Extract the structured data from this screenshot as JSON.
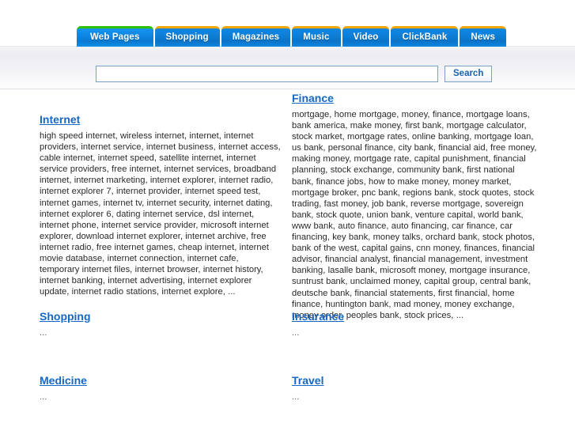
{
  "header": {
    "tabs": [
      {
        "label": "Web Pages",
        "active": true,
        "accent": "#2fc000"
      },
      {
        "label": "Shopping",
        "active": false,
        "accent": "#f0a500"
      },
      {
        "label": "Magazines",
        "active": false,
        "accent": "#f0a500"
      },
      {
        "label": "Music",
        "active": false,
        "accent": "#f0a500"
      },
      {
        "label": "Video",
        "active": false,
        "accent": "#f0a500"
      },
      {
        "label": "ClickBank",
        "active": false,
        "accent": "#f0a500"
      },
      {
        "label": "News",
        "active": false,
        "accent": "#f0a500"
      }
    ],
    "search": {
      "value": "",
      "placeholder": "",
      "button_label": "Search"
    }
  },
  "colors": {
    "tab_blue": "#0d7fd8",
    "link_blue": "#1568c8",
    "active_tab_accent": "#2fc000",
    "inactive_tab_accent": "#f0a500",
    "band_background": "#eceCf2",
    "input_border": "#7a9fcb",
    "body_text": "#2a2a2a"
  },
  "main": {
    "left_column": [
      {
        "title": "Internet",
        "terms": "high speed internet, wireless internet, internet, internet providers, internet service, internet business, internet access, cable internet, internet speed, satellite internet, internet service providers, free internet, internet services, broadband internet, internet marketing, internet explorer, internet radio, internet explorer 7, internet provider, internet speed test, internet games, internet tv, internet security, internet dating, internet explorer 6, dating internet service, dsl internet, internet phone, internet service provider, microsoft internet explorer, download internet explorer, internet archive, free internet radio, free internet games, cheap internet, internet movie database, internet connection, internet cafe, temporary internet files, internet browser, internet history, internet banking, internet advertising, internet explorer update, internet radio stations, internet explore,  ..."
      },
      {
        "title": "Shopping",
        "terms": "..."
      },
      {
        "title": "Medicine",
        "terms": "..."
      }
    ],
    "right_column": [
      {
        "title": "Finance",
        "terms": "mortgage, home mortgage, money, finance, mortgage loans, bank america, make money, first bank, mortgage calculator, stock market, mortgage rates, online banking, mortgage loan, us bank, personal finance, city bank, financial aid, free money, making money, mortgage rate, capital punishment, financial planning, stock exchange, community bank, first national bank, finance jobs, how to make money, money market, mortgage broker, pnc bank, regions bank, stock quotes, stock trading, fast money, job bank, reverse mortgage, sovereign bank, stock quote, union bank, venture capital, world bank, www bank, auto finance, auto financing, car finance, car financing, key bank, money talks, orchard bank, stock photos, bank of the west, capital gains, cnn money, finances, financial advisor, financial analyst, financial management, investment banking, lasalle bank, microsoft money, mortgage insurance, suntrust bank, unclaimed money, capital group, central bank, deutsche bank, financial statements, first financial, home finance, huntington bank, mad money, money exchange, money order, peoples bank, stock prices,  ..."
      },
      {
        "title": "Insurance",
        "terms": "..."
      },
      {
        "title": "Travel",
        "terms": "..."
      }
    ]
  }
}
